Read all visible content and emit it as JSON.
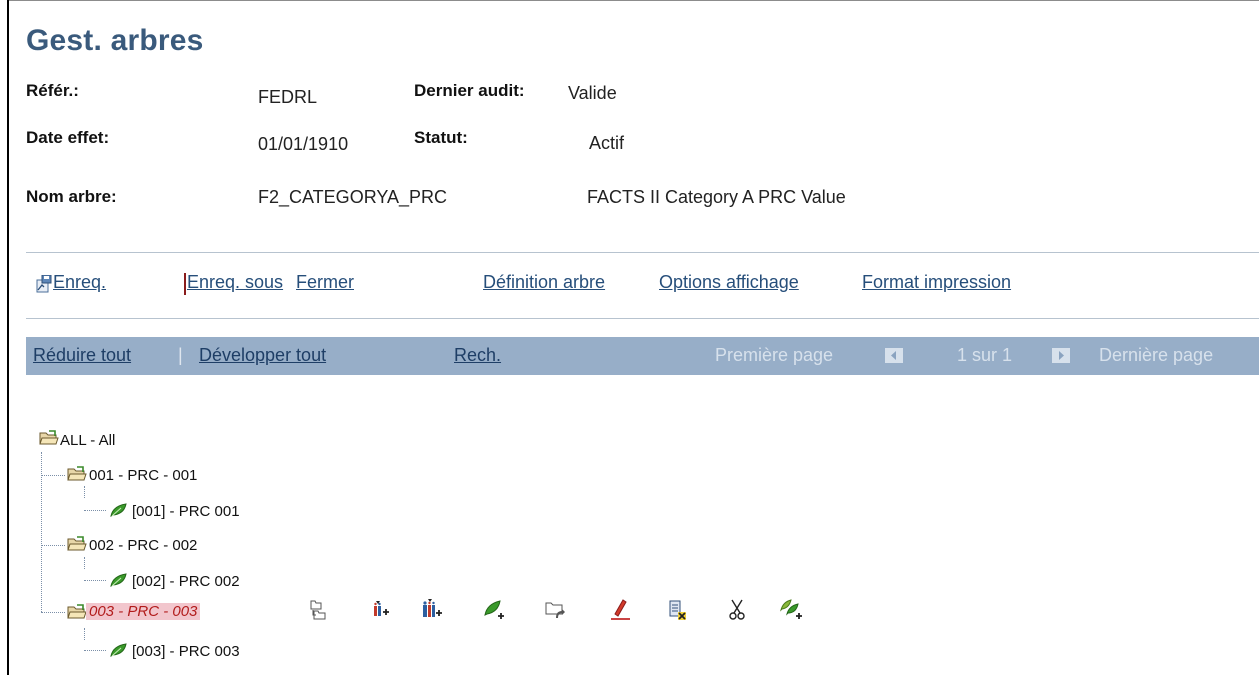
{
  "page": {
    "title": "Gest. arbres"
  },
  "header": {
    "ref_label": "Référ.:",
    "ref_value": "FEDRL",
    "audit_label": "Dernier audit:",
    "audit_value": "Valide",
    "date_label": "Date effet:",
    "date_value": "01/01/1910",
    "status_label": "Statut:",
    "status_value": "Actif",
    "tree_label": "Nom arbre:",
    "tree_value": "F2_CATEGORYA_PRC",
    "tree_desc": "FACTS II Category A PRC Value"
  },
  "toolbar": {
    "save": "Enreq.",
    "save_as": "Enreq. sous",
    "close": "Fermer",
    "tree_def": "Définition arbre",
    "display_opts": "Options affichage",
    "print_format": "Format impression"
  },
  "navbar": {
    "collapse_all": "Réduire tout",
    "divider": "|",
    "expand_all": "Développer tout",
    "search": "Rech.",
    "first_page": "Première page",
    "page_info": "1 sur 1",
    "last_page": "Dernière page"
  },
  "tree": {
    "root": "ALL - All",
    "nodes": [
      {
        "label": "001 - PRC - 001",
        "leaf": "[001] - PRC 001"
      },
      {
        "label": "002 - PRC - 002",
        "leaf": "[002] - PRC 002"
      },
      {
        "label": "003 - PRC - 003",
        "leaf": "[003] - PRC 003",
        "selected": true
      }
    ]
  },
  "node_actions": [
    "folder-move-icon",
    "insert-child-node-icon",
    "insert-sibling-node-icon",
    "insert-leaf-icon",
    "folder-undo-icon",
    "edit-data-icon",
    "delete-node-icon",
    "cut-icon",
    "insert-leaves-icon"
  ],
  "colors": {
    "title": "#3a5a7c",
    "link": "#264e7a",
    "navbar": "#97aec8",
    "selected_text": "#b21c1c",
    "selected_bg": "#f2c6cd",
    "leaf": "#3a9a2a"
  }
}
